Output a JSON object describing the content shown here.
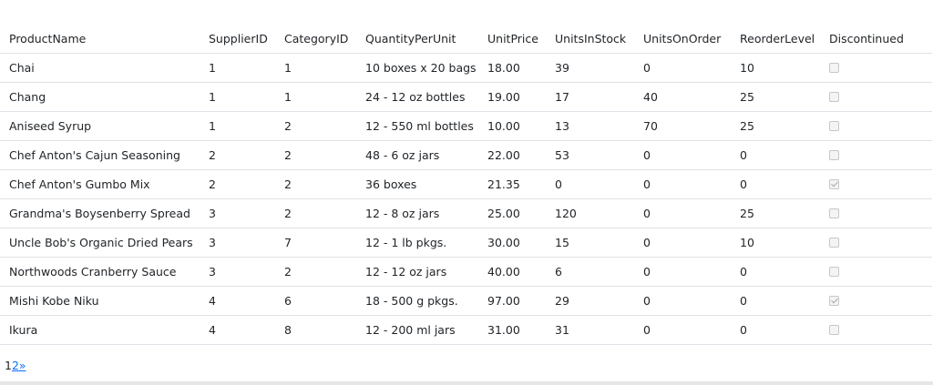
{
  "columns": [
    "ProductName",
    "SupplierID",
    "CategoryID",
    "QuantityPerUnit",
    "UnitPrice",
    "UnitsInStock",
    "UnitsOnOrder",
    "ReorderLevel",
    "Discontinued"
  ],
  "rows": [
    {
      "name": "Chai",
      "supplier": "1",
      "category": "1",
      "qty": "10 boxes x 20 bags",
      "price": "18.00",
      "stock": "39",
      "onorder": "0",
      "reorder": "10",
      "discontinued": false
    },
    {
      "name": "Chang",
      "supplier": "1",
      "category": "1",
      "qty": "24 - 12 oz bottles",
      "price": "19.00",
      "stock": "17",
      "onorder": "40",
      "reorder": "25",
      "discontinued": false
    },
    {
      "name": "Aniseed Syrup",
      "supplier": "1",
      "category": "2",
      "qty": "12 - 550 ml bottles",
      "price": "10.00",
      "stock": "13",
      "onorder": "70",
      "reorder": "25",
      "discontinued": false
    },
    {
      "name": "Chef Anton's Cajun Seasoning",
      "supplier": "2",
      "category": "2",
      "qty": "48 - 6 oz jars",
      "price": "22.00",
      "stock": "53",
      "onorder": "0",
      "reorder": "0",
      "discontinued": false
    },
    {
      "name": "Chef Anton's Gumbo Mix",
      "supplier": "2",
      "category": "2",
      "qty": "36 boxes",
      "price": "21.35",
      "stock": "0",
      "onorder": "0",
      "reorder": "0",
      "discontinued": true
    },
    {
      "name": "Grandma's Boysenberry Spread",
      "supplier": "3",
      "category": "2",
      "qty": "12 - 8 oz jars",
      "price": "25.00",
      "stock": "120",
      "onorder": "0",
      "reorder": "25",
      "discontinued": false
    },
    {
      "name": "Uncle Bob's Organic Dried Pears",
      "supplier": "3",
      "category": "7",
      "qty": "12 - 1 lb pkgs.",
      "price": "30.00",
      "stock": "15",
      "onorder": "0",
      "reorder": "10",
      "discontinued": false
    },
    {
      "name": "Northwoods Cranberry Sauce",
      "supplier": "3",
      "category": "2",
      "qty": "12 - 12 oz jars",
      "price": "40.00",
      "stock": "6",
      "onorder": "0",
      "reorder": "0",
      "discontinued": false
    },
    {
      "name": "Mishi Kobe Niku",
      "supplier": "4",
      "category": "6",
      "qty": "18 - 500 g pkgs.",
      "price": "97.00",
      "stock": "29",
      "onorder": "0",
      "reorder": "0",
      "discontinued": true
    },
    {
      "name": "Ikura",
      "supplier": "4",
      "category": "8",
      "qty": "12 - 200 ml jars",
      "price": "31.00",
      "stock": "31",
      "onorder": "0",
      "reorder": "0",
      "discontinued": false
    }
  ],
  "pager": {
    "current": "1",
    "next_page": "2",
    "next_arrow": "»"
  }
}
